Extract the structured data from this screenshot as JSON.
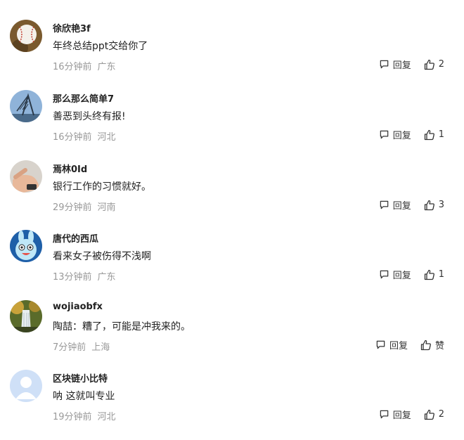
{
  "comments": [
    {
      "username": "徐欣艳3f",
      "text": "年终总结ppt交给你了",
      "time": "16分钟前",
      "location": "广东",
      "reply_label": "回复",
      "likes": "2",
      "avatar_icon": "baseball-avatar"
    },
    {
      "username": "那么那么简单7",
      "text": "善恶到头终有报!",
      "time": "16分钟前",
      "location": "河北",
      "reply_label": "回复",
      "likes": "1",
      "avatar_icon": "sculpture-avatar"
    },
    {
      "username": "焉林0Id",
      "text": "银行工作的习惯就好。",
      "time": "29分钟前",
      "location": "河南",
      "reply_label": "回复",
      "likes": "3",
      "avatar_icon": "hand-avatar"
    },
    {
      "username": "唐代的西瓜",
      "text": "看来女子被伤得不浅啊",
      "time": "13分钟前",
      "location": "广东",
      "reply_label": "回复",
      "likes": "1",
      "avatar_icon": "cartoon-rabbit-avatar"
    },
    {
      "username": "wojiaobfx",
      "text": "陶喆：糟了，可能是冲我来的。",
      "time": "7分钟前",
      "location": "上海",
      "reply_label": "回复",
      "likes": "赞",
      "avatar_icon": "waterfall-avatar"
    },
    {
      "username": "区块链小比特",
      "text": "呐 这就叫专业",
      "time": "19分钟前",
      "location": "河北",
      "reply_label": "回复",
      "likes": "2",
      "avatar_icon": "default-user-avatar"
    }
  ]
}
